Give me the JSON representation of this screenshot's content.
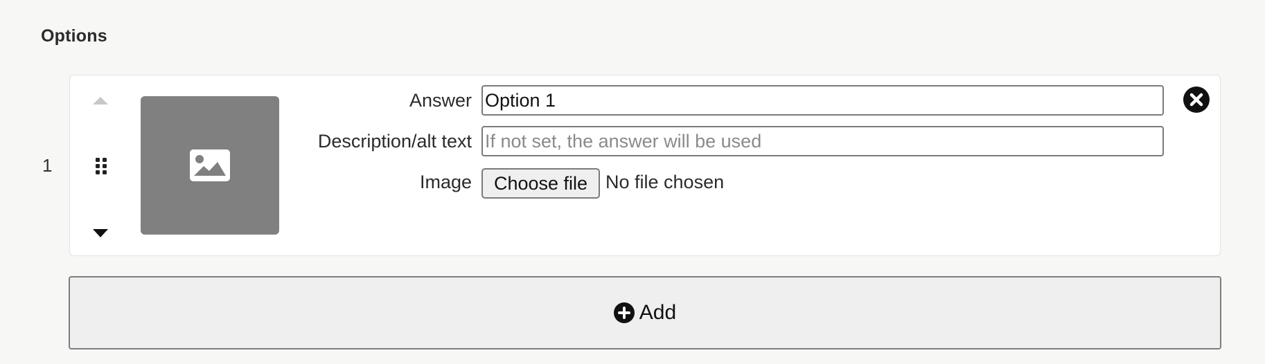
{
  "section": {
    "title": "Options"
  },
  "options": [
    {
      "number": "1",
      "answer_label": "Answer",
      "answer_value": "Option 1",
      "description_label": "Description/alt text",
      "description_placeholder": "If not set, the answer will be used",
      "image_label": "Image",
      "file_button_label": "Choose file",
      "file_status": "No file chosen",
      "icons": {
        "move_up": "caret-up-icon",
        "drag": "drag-handle-icon",
        "move_down": "caret-down-icon",
        "image": "image-icon",
        "remove": "circle-x-icon"
      }
    }
  ],
  "add_button": {
    "label": "Add",
    "icon": "plus-circle-icon"
  },
  "colors": {
    "page_background": "#f7f7f6",
    "card_background": "#ffffff",
    "placeholder_background": "#808080",
    "button_background": "#efefef",
    "disabled_arrow": "#c8c8c8"
  }
}
